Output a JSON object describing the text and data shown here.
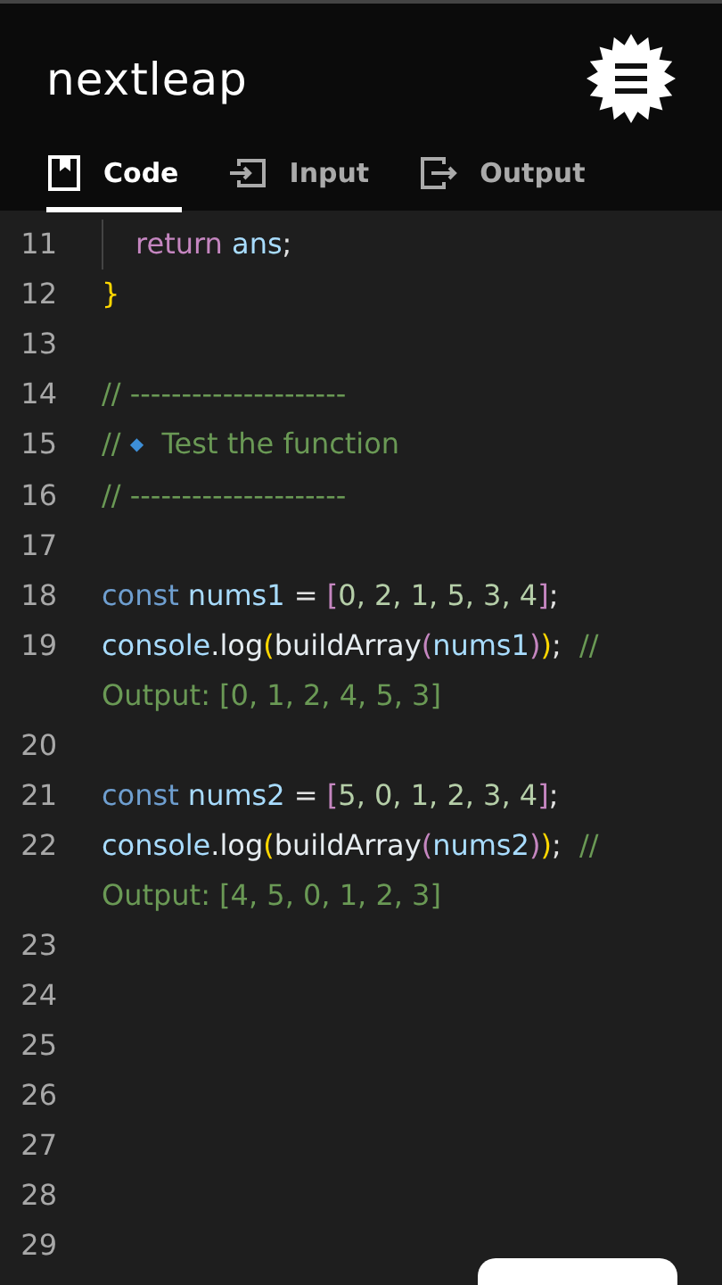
{
  "header": {
    "logo": "nextleap"
  },
  "tabs": [
    {
      "label": "Code",
      "kind": "code",
      "selected": true
    },
    {
      "label": "Input",
      "kind": "input",
      "selected": false
    },
    {
      "label": "Output",
      "kind": "output",
      "selected": false
    }
  ],
  "editor": {
    "lines": [
      {
        "number": "11",
        "indent": true,
        "tokens": [
          {
            "text": "return ",
            "kind": "keyword2"
          },
          {
            "text": "ans",
            "kind": "ident"
          },
          {
            "text": ";",
            "kind": "punct"
          }
        ]
      },
      {
        "number": "12",
        "tokens": [
          {
            "text": "}",
            "kind": "brace"
          }
        ]
      },
      {
        "number": "13"
      },
      {
        "number": "14",
        "tokens": [
          {
            "text": "// ---------------------",
            "kind": "comment"
          }
        ]
      },
      {
        "number": "15",
        "tokens": [
          {
            "text": "// ",
            "kind": "comment"
          },
          {
            "text": "◆",
            "kind": "bullet"
          },
          {
            "text": "  Test the function",
            "kind": "comment"
          }
        ]
      },
      {
        "number": "16",
        "tokens": [
          {
            "text": "// ---------------------",
            "kind": "comment"
          }
        ]
      },
      {
        "number": "17"
      },
      {
        "number": "18",
        "tokens": [
          {
            "text": "const ",
            "kind": "keyword"
          },
          {
            "text": "nums1",
            "kind": "ident"
          },
          {
            "text": " = ",
            "kind": "punct"
          },
          {
            "text": "[",
            "kind": "bracket"
          },
          {
            "text": "0, 2, 1, 5, 3, 4",
            "kind": "number"
          },
          {
            "text": "]",
            "kind": "bracket"
          },
          {
            "text": ";",
            "kind": "punct"
          }
        ]
      },
      {
        "number": "19",
        "tokens": [
          {
            "text": "console",
            "kind": "ident"
          },
          {
            "text": ".log",
            "kind": "func"
          },
          {
            "text": "(",
            "kind": "paren"
          },
          {
            "text": "buildArray",
            "kind": "func"
          },
          {
            "text": "(",
            "kind": "bracket"
          },
          {
            "text": "nums1",
            "kind": "ident"
          },
          {
            "text": ")",
            "kind": "bracket"
          },
          {
            "text": ")",
            "kind": "paren"
          },
          {
            "text": ";  ",
            "kind": "punct"
          },
          {
            "text": "// Output: [0, 1, 2, 4, 5, 3]",
            "kind": "comment"
          }
        ]
      },
      {
        "number": "20"
      },
      {
        "number": "21",
        "tokens": [
          {
            "text": "const ",
            "kind": "keyword"
          },
          {
            "text": "nums2",
            "kind": "ident"
          },
          {
            "text": " = ",
            "kind": "punct"
          },
          {
            "text": "[",
            "kind": "bracket"
          },
          {
            "text": "5, 0, 1, 2, 3, 4",
            "kind": "number"
          },
          {
            "text": "]",
            "kind": "bracket"
          },
          {
            "text": ";",
            "kind": "punct"
          }
        ]
      },
      {
        "number": "22",
        "tokens": [
          {
            "text": "console",
            "kind": "ident"
          },
          {
            "text": ".log",
            "kind": "func"
          },
          {
            "text": "(",
            "kind": "paren"
          },
          {
            "text": "buildArray",
            "kind": "func"
          },
          {
            "text": "(",
            "kind": "bracket"
          },
          {
            "text": "nums2",
            "kind": "ident"
          },
          {
            "text": ")",
            "kind": "bracket"
          },
          {
            "text": ")",
            "kind": "paren"
          },
          {
            "text": ";  ",
            "kind": "punct"
          },
          {
            "text": "// Output: [4, 5, 0, 1, 2, 3]",
            "kind": "comment"
          }
        ]
      },
      {
        "number": "23"
      },
      {
        "number": "24"
      },
      {
        "number": "25"
      },
      {
        "number": "26"
      },
      {
        "number": "27"
      },
      {
        "number": "28"
      },
      {
        "number": "29"
      }
    ]
  }
}
